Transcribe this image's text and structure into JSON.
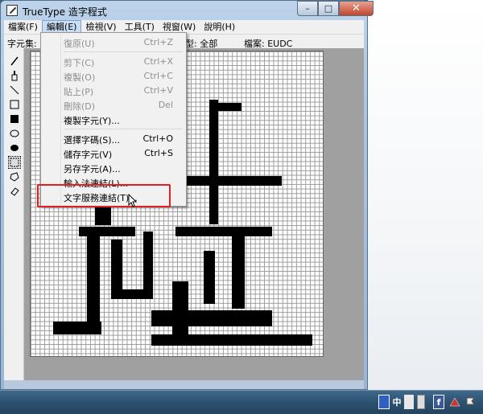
{
  "window": {
    "title": "TrueType 造字程式",
    "controls": {
      "minimize": "–",
      "maximize": "□",
      "close": "✕"
    }
  },
  "menubar": [
    {
      "label": "檔案(F)"
    },
    {
      "label": "編輯(E)"
    },
    {
      "label": "檢視(V)"
    },
    {
      "label": "工具(T)"
    },
    {
      "label": "視窗(W)"
    },
    {
      "label": "說明(H)"
    }
  ],
  "infobar": {
    "charset_label": "字元集:",
    "font_value": "型: 全部",
    "file_value": "檔案: EUDC"
  },
  "tools": [
    "pencil-icon",
    "brush-icon",
    "line-icon",
    "hollow-rect-icon",
    "filled-rect-icon",
    "hollow-ellipse-icon",
    "filled-ellipse-icon",
    "rect-select-icon",
    "freeform-select-icon",
    "eraser-icon"
  ],
  "edit_menu": [
    {
      "label": "復原(U)",
      "shortcut": "Ctrl+Z",
      "disabled": true
    },
    {
      "label": "剪下(C)",
      "shortcut": "Ctrl+X",
      "disabled": true
    },
    {
      "label": "複製(O)",
      "shortcut": "Ctrl+C",
      "disabled": true
    },
    {
      "label": "貼上(P)",
      "shortcut": "Ctrl+V",
      "disabled": true
    },
    {
      "label": "刪除(D)",
      "shortcut": "Del",
      "disabled": true
    },
    {
      "label": "複製字元(Y)...",
      "shortcut": "",
      "disabled": false
    },
    {
      "label": "選擇字碼(S)...",
      "shortcut": "Ctrl+O",
      "disabled": false
    },
    {
      "label": "儲存字元(V)",
      "shortcut": "Ctrl+S",
      "disabled": false
    },
    {
      "label": "另存字元(A)...",
      "shortcut": "",
      "disabled": false
    },
    {
      "label": "輸入法連結(L)...",
      "shortcut": "",
      "disabled": false
    },
    {
      "label": "文字服務連結(T)...",
      "shortcut": "",
      "disabled": false
    }
  ],
  "taskbar": {
    "tray": [
      "ime-icon",
      "中",
      "keyboard-icon",
      "help-icon",
      "facebook-icon",
      "network-icon",
      "flag-icon"
    ]
  },
  "colors": {
    "highlight_box": "#e02020",
    "titlebar": "#bcd3ea"
  }
}
